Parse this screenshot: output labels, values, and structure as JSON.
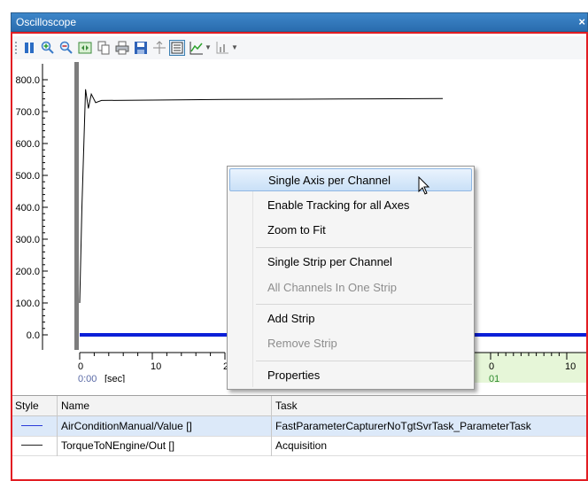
{
  "window": {
    "title": "Oscilloscope",
    "close_glyph": "×"
  },
  "toolbar": {
    "icons": [
      "pause-icon",
      "zoom-in-icon",
      "zoom-out-icon",
      "fit-icon",
      "copy-icon",
      "print-icon",
      "save-icon",
      "cursor-icon",
      "legend-icon",
      "chart-icon",
      "axis-icon"
    ]
  },
  "plot": {
    "y_ticks": [
      "800.0",
      "700.0",
      "600.0",
      "500.0",
      "400.0",
      "300.0",
      "200.0",
      "100.0",
      "0.0"
    ],
    "x_left_ticks": [
      "0",
      "10",
      "20"
    ],
    "x_time": "0:00",
    "x_unit": "[sec]",
    "x_right_ticks": [
      "0",
      "10"
    ],
    "x_right_sub": "01"
  },
  "chart_data": {
    "type": "line",
    "ylim": [
      0,
      800
    ],
    "series": [
      {
        "name": "AirConditionManual/Value []",
        "color": "#0a1fd8",
        "x": [
          0,
          120
        ],
        "values": [
          0,
          0
        ]
      },
      {
        "name": "TorqueToNEngine/Out []",
        "color": "#000000",
        "x": [
          0,
          0.3,
          0.8,
          1.2,
          1.6,
          2.2,
          3,
          10,
          20,
          30,
          40,
          50
        ],
        "values": [
          100,
          400,
          770,
          710,
          755,
          728,
          735,
          736,
          738,
          739,
          740,
          741
        ]
      }
    ]
  },
  "legend": {
    "headers": {
      "style": "Style",
      "name": "Name",
      "task": "Task"
    },
    "rows": [
      {
        "color": "#2a3bd9",
        "name": "AirConditionManual/Value []",
        "task": "FastParameterCapturerNoTgtSvrTask_ParameterTask"
      },
      {
        "color": "#222222",
        "name": "TorqueToNEngine/Out []",
        "task": "Acquisition"
      }
    ]
  },
  "context_menu": {
    "items": [
      {
        "label": "Single Axis per Channel",
        "enabled": true,
        "highlighted": true
      },
      {
        "label": "Enable Tracking for all Axes",
        "enabled": true
      },
      {
        "label": "Zoom to Fit",
        "enabled": true
      },
      {
        "label": "Single Strip per Channel",
        "enabled": true
      },
      {
        "label": "All Channels In One Strip",
        "enabled": false
      },
      {
        "label": "Add Strip",
        "enabled": true
      },
      {
        "label": "Remove Strip",
        "enabled": false
      },
      {
        "label": "Properties",
        "enabled": true
      }
    ]
  }
}
